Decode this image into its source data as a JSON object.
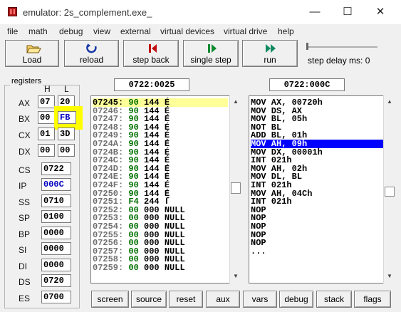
{
  "window": {
    "title": "emulator: 2s_complement.exe_",
    "minimize": "—",
    "maximize": "☐",
    "close": "✕"
  },
  "menu": [
    "file",
    "math",
    "debug",
    "view",
    "external",
    "virtual devices",
    "virtual drive",
    "help"
  ],
  "toolbar": {
    "load": "Load",
    "reload": "reload",
    "step_back": "step back",
    "single_step": "single step",
    "run": "run",
    "step_delay": "step delay ms: 0",
    "step_delay_value": 0
  },
  "registers": {
    "title": "registers",
    "h": "H",
    "l": "L",
    "ax": {
      "name": "AX",
      "h": "07",
      "l": "20"
    },
    "bx": {
      "name": "BX",
      "h": "00",
      "l": "FB"
    },
    "cx": {
      "name": "CX",
      "h": "01",
      "l": "3D"
    },
    "dx": {
      "name": "DX",
      "h": "00",
      "l": "00"
    },
    "cs": {
      "name": "CS",
      "v": "0722"
    },
    "ip": {
      "name": "IP",
      "v": "000C"
    },
    "ss": {
      "name": "SS",
      "v": "0710"
    },
    "sp": {
      "name": "SP",
      "v": "0100"
    },
    "bp": {
      "name": "BP",
      "v": "0000"
    },
    "si": {
      "name": "SI",
      "v": "0000"
    },
    "di": {
      "name": "DI",
      "v": "0000"
    },
    "ds": {
      "name": "DS",
      "v": "0720"
    },
    "es": {
      "name": "ES",
      "v": "0700"
    }
  },
  "memory_address": "0722:0025",
  "disasm_address": "0722:000C",
  "memory_lines": [
    {
      "addr": "07245:",
      "hex": "90",
      "dec": "144",
      "ch": "É"
    },
    {
      "addr": "07246:",
      "hex": "90",
      "dec": "144",
      "ch": "É"
    },
    {
      "addr": "07247:",
      "hex": "90",
      "dec": "144",
      "ch": "É"
    },
    {
      "addr": "07248:",
      "hex": "90",
      "dec": "144",
      "ch": "É"
    },
    {
      "addr": "07249:",
      "hex": "90",
      "dec": "144",
      "ch": "É"
    },
    {
      "addr": "0724A:",
      "hex": "90",
      "dec": "144",
      "ch": "É"
    },
    {
      "addr": "0724B:",
      "hex": "90",
      "dec": "144",
      "ch": "É"
    },
    {
      "addr": "0724C:",
      "hex": "90",
      "dec": "144",
      "ch": "É"
    },
    {
      "addr": "0724D:",
      "hex": "90",
      "dec": "144",
      "ch": "É"
    },
    {
      "addr": "0724E:",
      "hex": "90",
      "dec": "144",
      "ch": "É"
    },
    {
      "addr": "0724F:",
      "hex": "90",
      "dec": "144",
      "ch": "É"
    },
    {
      "addr": "07250:",
      "hex": "90",
      "dec": "144",
      "ch": "É"
    },
    {
      "addr": "07251:",
      "hex": "F4",
      "dec": "244",
      "ch": "ſ"
    },
    {
      "addr": "07252:",
      "hex": "00",
      "dec": "000",
      "ch": "NULL"
    },
    {
      "addr": "07253:",
      "hex": "00",
      "dec": "000",
      "ch": "NULL"
    },
    {
      "addr": "07254:",
      "hex": "00",
      "dec": "000",
      "ch": "NULL"
    },
    {
      "addr": "07255:",
      "hex": "00",
      "dec": "000",
      "ch": "NULL"
    },
    {
      "addr": "07256:",
      "hex": "00",
      "dec": "000",
      "ch": "NULL"
    },
    {
      "addr": "07257:",
      "hex": "00",
      "dec": "000",
      "ch": "NULL"
    },
    {
      "addr": "07258:",
      "hex": "00",
      "dec": "000",
      "ch": "NULL"
    },
    {
      "addr": "07259:",
      "hex": "00",
      "dec": "000",
      "ch": "NULL"
    }
  ],
  "disasm_lines": [
    "MOV AX, 00720h",
    "MOV DS, AX",
    "MOV BL, 05h",
    "NOT BL",
    "ADD BL, 01h",
    "MOV AH, 09h",
    "MOV DX, 00001h",
    "INT 021h",
    "MOV AH, 02h",
    "MOV DL, BL",
    "INT 021h",
    "MOV AH, 04Ch",
    "INT 021h",
    "NOP",
    "NOP",
    "NOP",
    "NOP",
    "NOP",
    "..."
  ],
  "bottom_buttons": [
    "screen",
    "source",
    "reset",
    "aux",
    "vars",
    "debug",
    "stack",
    "flags"
  ],
  "colors": {
    "mem_hl": "#ffff99",
    "disasm_hl": "#0000ff",
    "hex_green": "#007000",
    "addr_gray": "#707070",
    "blue_text": "#0000c0"
  }
}
